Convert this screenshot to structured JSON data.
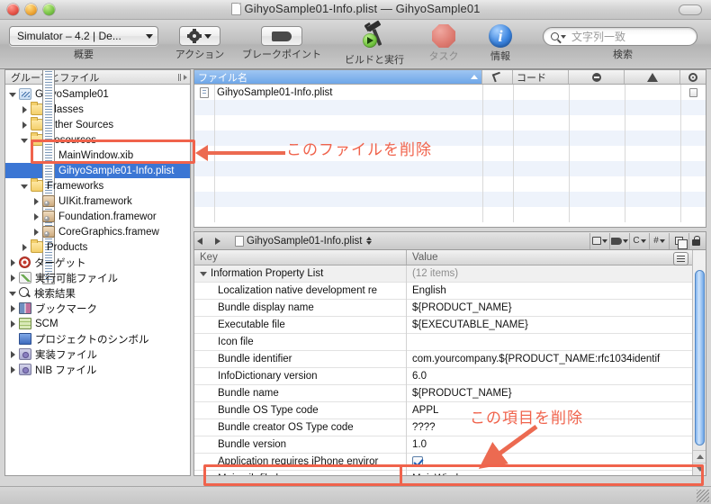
{
  "window": {
    "title": "GihyoSample01-Info.plist — GihyoSample01",
    "doc_icon": "document-icon"
  },
  "toolbar": {
    "scheme_button": {
      "label": "Simulator – 4.2 | De...",
      "caption": "概要"
    },
    "action_button": {
      "caption": "アクション",
      "icon": "gear-icon"
    },
    "breakpoint_button": {
      "caption": "ブレークポイント",
      "icon": "breakpoint-icon"
    },
    "build_run_button": {
      "caption": "ビルドと実行",
      "icon": "hammer-run-icon"
    },
    "tasks_button": {
      "caption": "タスク",
      "icon": "stop-octagon-icon"
    },
    "info_button": {
      "caption": "情報",
      "icon": "info-icon"
    },
    "search": {
      "placeholder": "文字列一致",
      "caption": "検索",
      "icon": "search-icon"
    }
  },
  "sidebar": {
    "header": "グループとファイル",
    "items": [
      {
        "label": "GihyoSample01",
        "indent": 0,
        "disclosure": "open",
        "icon": "project-icon",
        "selected": false
      },
      {
        "label": "Classes",
        "indent": 1,
        "disclosure": "closed",
        "icon": "folder-icon",
        "selected": false
      },
      {
        "label": "Other Sources",
        "indent": 1,
        "disclosure": "closed",
        "icon": "folder-icon",
        "selected": false
      },
      {
        "label": "Resources",
        "indent": 1,
        "disclosure": "open",
        "icon": "folder-icon",
        "selected": false
      },
      {
        "label": "MainWindow.xib",
        "indent": 2,
        "disclosure": "none",
        "icon": "xib-icon",
        "selected": false
      },
      {
        "label": "GihyoSample01-Info.plist",
        "indent": 2,
        "disclosure": "none",
        "icon": "plist-icon",
        "selected": true
      },
      {
        "label": "Frameworks",
        "indent": 1,
        "disclosure": "open",
        "icon": "folder-icon",
        "selected": false
      },
      {
        "label": "UIKit.framework",
        "indent": 2,
        "disclosure": "closed",
        "icon": "framework-icon",
        "selected": false
      },
      {
        "label": "Foundation.framewor",
        "indent": 2,
        "disclosure": "closed",
        "icon": "framework-icon",
        "selected": false
      },
      {
        "label": "CoreGraphics.framew",
        "indent": 2,
        "disclosure": "closed",
        "icon": "framework-icon",
        "selected": false
      },
      {
        "label": "Products",
        "indent": 1,
        "disclosure": "closed",
        "icon": "folder-icon",
        "selected": false
      },
      {
        "label": "ターゲット",
        "indent": 0,
        "disclosure": "closed",
        "icon": "target-icon",
        "selected": false
      },
      {
        "label": "実行可能ファイル",
        "indent": 0,
        "disclosure": "closed",
        "icon": "executable-icon",
        "selected": false
      },
      {
        "label": "検索結果",
        "indent": 0,
        "disclosure": "open",
        "icon": "search-results-icon",
        "selected": false
      },
      {
        "label": "ブックマーク",
        "indent": 0,
        "disclosure": "closed",
        "icon": "bookmark-icon",
        "selected": false
      },
      {
        "label": "SCM",
        "indent": 0,
        "disclosure": "closed",
        "icon": "scm-icon",
        "selected": false
      },
      {
        "label": "プロジェクトのシンボル",
        "indent": 0,
        "disclosure": "none",
        "icon": "symbol-icon",
        "selected": false
      },
      {
        "label": "実装ファイル",
        "indent": 0,
        "disclosure": "closed",
        "icon": "smart-folder-icon",
        "selected": false
      },
      {
        "label": "NIB ファイル",
        "indent": 0,
        "disclosure": "closed",
        "icon": "smart-folder-icon",
        "selected": false
      }
    ]
  },
  "filelist": {
    "columns": [
      {
        "label": "ファイル名",
        "icon": "",
        "sorted": true
      },
      {
        "label": "",
        "icon": "hammer-icon",
        "sorted": false
      },
      {
        "label": "コード",
        "icon": "",
        "sorted": false
      },
      {
        "label": "",
        "icon": "error-icon",
        "sorted": false
      },
      {
        "label": "",
        "icon": "warning-icon",
        "sorted": false
      },
      {
        "label": "",
        "icon": "target-small-icon",
        "sorted": false
      }
    ],
    "rows": [
      {
        "name": "GihyoSample01-Info.plist",
        "icon": "plist-icon",
        "code": "",
        "has_last": true
      }
    ]
  },
  "editor": {
    "nav_back_icon": "arrow-left-icon",
    "nav_forward_icon": "arrow-right-icon",
    "document": "GihyoSample01-Info.plist",
    "tools": [
      {
        "name": "window-layout-icon"
      },
      {
        "name": "bookmark-tag-icon"
      },
      {
        "name": "class-c-icon",
        "label": "C"
      },
      {
        "name": "counterpart-hash-icon",
        "label": "#"
      },
      {
        "name": "split-editor-icon"
      },
      {
        "name": "lock-icon"
      }
    ],
    "table": {
      "headers": {
        "key": "Key",
        "value": "Value"
      },
      "rows": [
        {
          "key": "Information Property List",
          "value": "(12 items)",
          "type": "group",
          "dim": true
        },
        {
          "key": "Localization native development re",
          "value": "English",
          "type": "item",
          "dim": false
        },
        {
          "key": "Bundle display name",
          "value": "${PRODUCT_NAME}",
          "type": "item",
          "dim": false
        },
        {
          "key": "Executable file",
          "value": "${EXECUTABLE_NAME}",
          "type": "item",
          "dim": false
        },
        {
          "key": "Icon file",
          "value": "",
          "type": "item",
          "dim": false
        },
        {
          "key": "Bundle identifier",
          "value": "com.yourcompany.${PRODUCT_NAME:rfc1034identif",
          "type": "item",
          "dim": false
        },
        {
          "key": "InfoDictionary version",
          "value": "6.0",
          "type": "item",
          "dim": false
        },
        {
          "key": "Bundle name",
          "value": "${PRODUCT_NAME}",
          "type": "item",
          "dim": false
        },
        {
          "key": "Bundle OS Type code",
          "value": "APPL",
          "type": "item",
          "dim": false
        },
        {
          "key": "Bundle creator OS Type code",
          "value": "????",
          "type": "item",
          "dim": false
        },
        {
          "key": "Bundle version",
          "value": "1.0",
          "type": "item",
          "dim": false
        },
        {
          "key": "Application requires iPhone enviror",
          "value": "",
          "type": "checkbox",
          "dim": false
        },
        {
          "key": "Main nib file base name",
          "value": "MainWindow",
          "type": "item",
          "dim": false,
          "highlighted": true
        }
      ]
    }
  },
  "annotations": [
    {
      "text": "このファイルを削除",
      "target": "MainWindow.xib"
    },
    {
      "text": "この項目を削除",
      "target": "Main nib file base name"
    }
  ],
  "colors": {
    "annotation": "#f0634c",
    "selection": "#3b76d4",
    "alt_row": "#eef3fb"
  }
}
